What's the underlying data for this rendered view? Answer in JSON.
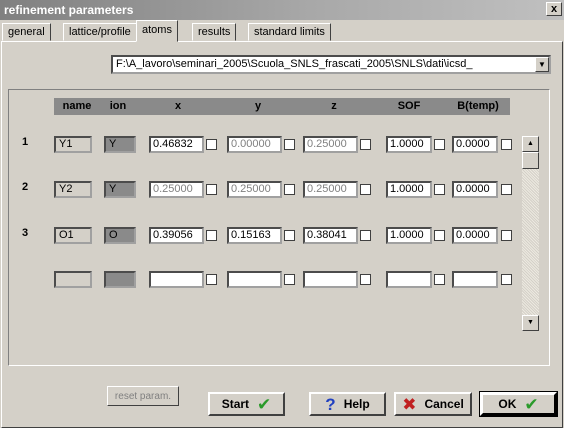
{
  "window": {
    "title": "refinement parameters",
    "close_label": "x"
  },
  "tabs": [
    {
      "label": "general"
    },
    {
      "label": "lattice/profile"
    },
    {
      "label": "atoms"
    },
    {
      "label": "results"
    },
    {
      "label": "standard limits"
    }
  ],
  "file_path": "F:\\A_lavoro\\seminari_2005\\Scuola_SNLS_frascati_2005\\SNLS\\dati\\icsd_",
  "columns": {
    "name": "name",
    "ion": "ion",
    "x": "x",
    "y": "y",
    "z": "z",
    "sof": "SOF",
    "btemp": "B(temp)"
  },
  "rows": [
    {
      "num": "1",
      "name": "Y1",
      "ion": "Y",
      "x": "0.46832",
      "y": "0.00000",
      "z": "0.25000",
      "sof": "1.0000",
      "btemp": "0.0000"
    },
    {
      "num": "2",
      "name": "Y2",
      "ion": "Y",
      "x": "0.25000",
      "y": "0.25000",
      "z": "0.25000",
      "sof": "1.0000",
      "btemp": "0.0000"
    },
    {
      "num": "3",
      "name": "O1",
      "ion": "O",
      "x": "0.39056",
      "y": "0.15163",
      "z": "0.38041",
      "sof": "1.0000",
      "btemp": "0.0000"
    }
  ],
  "buttons": {
    "reset": "reset param.",
    "start": "Start",
    "help": "Help",
    "cancel": "Cancel",
    "ok": "OK"
  },
  "colors": {
    "title_gradient": "#808080",
    "header_gray": "#8a8a8a",
    "check_green": "#2a9a2a",
    "cancel_red": "#c02020"
  }
}
